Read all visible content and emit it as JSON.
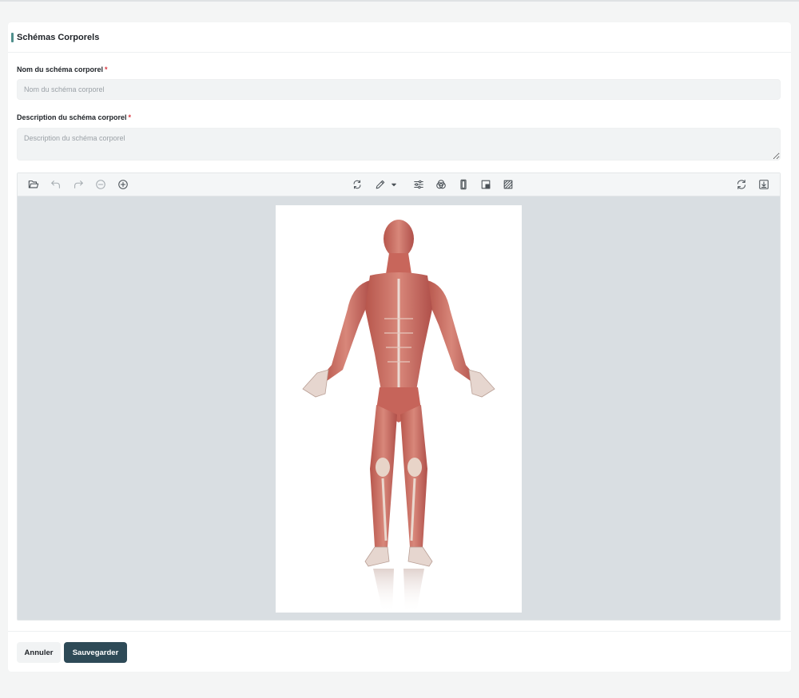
{
  "header": {
    "title": "Schémas Corporels"
  },
  "form": {
    "name": {
      "label": "Nom du schéma corporel",
      "required_mark": "*",
      "placeholder": "Nom du schéma corporel",
      "value": ""
    },
    "description": {
      "label": "Description du schéma corporel",
      "required_mark": "*",
      "placeholder": "Description du schéma corporel",
      "value": ""
    }
  },
  "editor": {
    "toolbar_left": [
      "folder-open-icon",
      "undo-icon",
      "redo-icon",
      "zoom-out-icon",
      "zoom-in-icon"
    ],
    "toolbar_center": [
      "rotate-icon",
      "pencil-icon",
      "chevron-down-icon",
      "adjust-sliders-icon",
      "color-filter-icon",
      "portrait-frame-icon",
      "crop-icon",
      "hatch-pattern-icon"
    ],
    "toolbar_right": [
      "refresh-icon",
      "download-icon"
    ],
    "image": {
      "subject": "anatomical muscle figure",
      "background": "#ffffff"
    }
  },
  "actions": {
    "cancel_label": "Annuler",
    "save_label": "Sauvegarder"
  },
  "colors": {
    "accent": "#4f8f8c",
    "primary_button": "#2e4a57",
    "required": "#d9363e",
    "editor_canvas": "#d9dee2"
  }
}
